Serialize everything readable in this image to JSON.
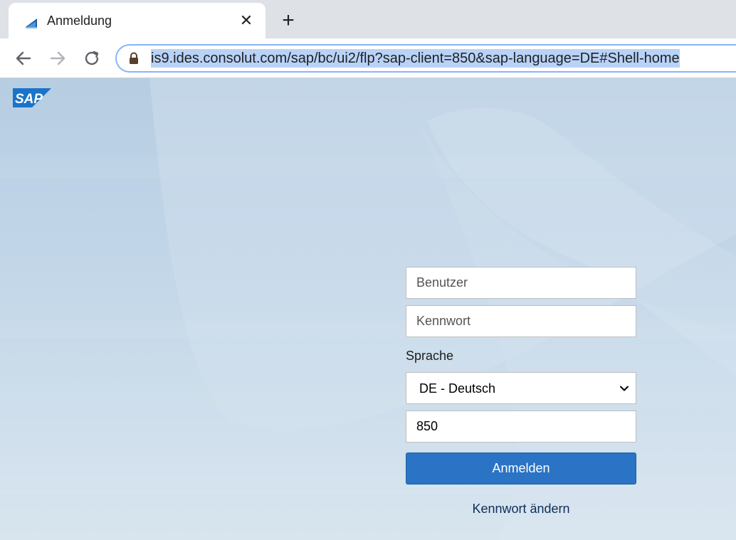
{
  "browser": {
    "tab": {
      "title": "Anmeldung",
      "close_glyph": "✕"
    },
    "new_tab_glyph": "+",
    "address_bar": {
      "url": "is9.ides.consolut.com/sap/bc/ui2/flp?sap-client=850&sap-language=DE#Shell-home"
    },
    "icons": {
      "favicon": "sap-favicon-icon",
      "back": "arrow-left-icon",
      "forward": "arrow-right-icon",
      "reload": "reload-icon",
      "lock": "lock-icon"
    }
  },
  "page": {
    "logo": "SAP",
    "login": {
      "user_placeholder": "Benutzer",
      "password_placeholder": "Kennwort",
      "language_label": "Sprache",
      "language_value": "DE - Deutsch",
      "client_value": "850",
      "login_button": "Anmelden",
      "change_password_link": "Kennwort ändern"
    },
    "colors": {
      "primary_button": "#2a73c5",
      "link": "#0f2d5c",
      "sap_blue": "#1a74c8"
    }
  }
}
